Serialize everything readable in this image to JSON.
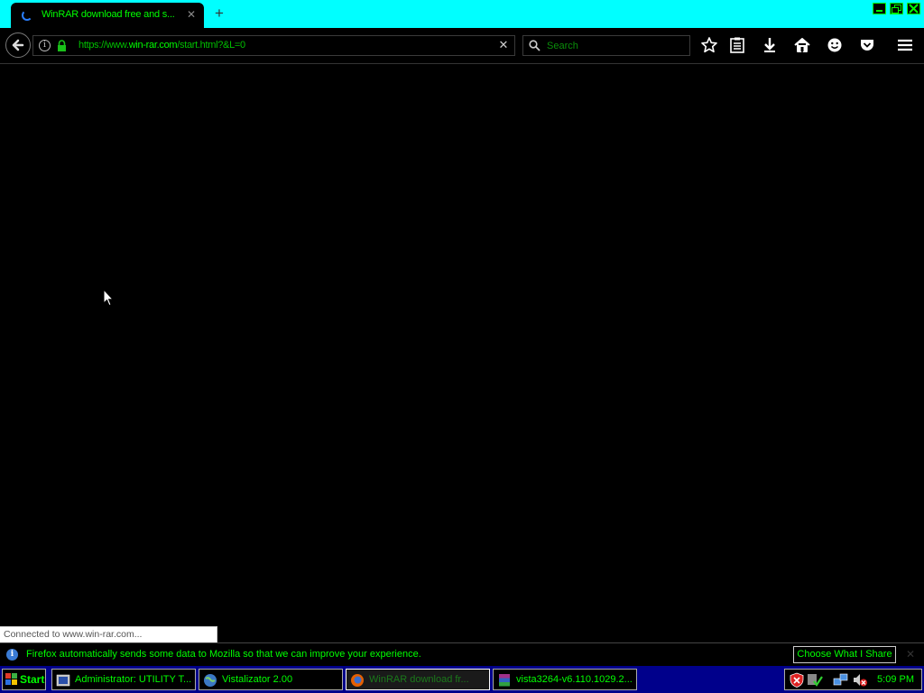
{
  "window": {
    "tab_title": "WinRAR download free and s...",
    "new_tab_symbol": "+",
    "tab_close_symbol": "✕"
  },
  "navbar": {
    "url_prefix": "https://www.",
    "url_domain": "win-rar.com",
    "url_path": "/start.html?&L=0",
    "url_clear_symbol": "✕",
    "search_placeholder": "Search"
  },
  "toolbar_icons": [
    "bookmark-star-icon",
    "reader-view-icon",
    "download-icon",
    "home-icon",
    "smiley-icon",
    "pocket-icon",
    "hamburger-menu-icon"
  ],
  "status": {
    "text": "Connected to www.win-rar.com..."
  },
  "notification": {
    "text": "Firefox automatically sends some data to Mozilla so that we can improve your experience.",
    "button_label": "Choose What I Share",
    "close_symbol": "✕"
  },
  "taskbar": {
    "start_label": "Start",
    "tasks": [
      {
        "label": "Administrator:  UTILITY T...",
        "icon": "console-icon"
      },
      {
        "label": "Vistalizator 2.00",
        "icon": "globe-icon"
      },
      {
        "label": "WinRAR download fr...",
        "icon": "firefox-icon",
        "active": true
      },
      {
        "label": "vista3264-v6.110.1029.2...",
        "icon": "winrar-icon"
      }
    ],
    "clock": "5:09 PM"
  },
  "colors": {
    "tabbar_bg": "#00ffff",
    "accent_text": "#00ff00",
    "taskbar_bg": "#00008b"
  }
}
